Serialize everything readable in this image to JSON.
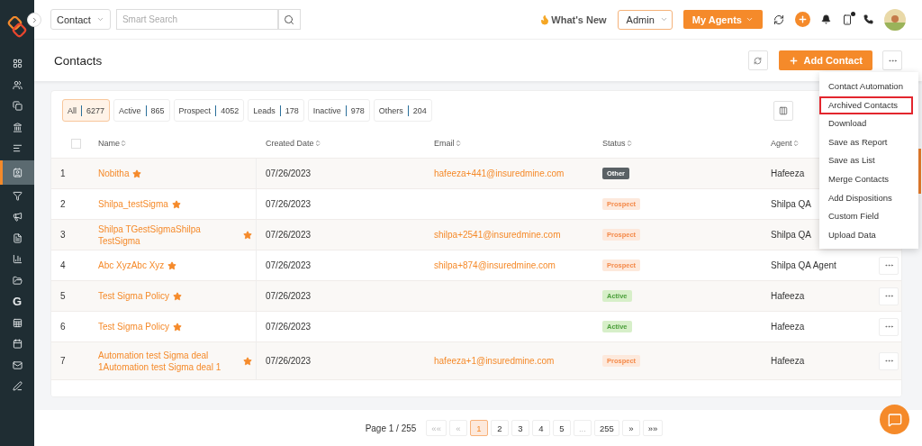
{
  "sidebar": {
    "items": [
      {
        "kind": "dashboard",
        "selected": false
      },
      {
        "kind": "users",
        "selected": false
      },
      {
        "kind": "copy",
        "selected": false
      },
      {
        "kind": "bank",
        "selected": false
      },
      {
        "kind": "list",
        "selected": false
      },
      {
        "kind": "contact",
        "selected": true
      },
      {
        "kind": "funnel",
        "selected": false
      },
      {
        "kind": "megaphone",
        "selected": false
      },
      {
        "kind": "document",
        "selected": false
      },
      {
        "kind": "chart",
        "selected": false
      },
      {
        "kind": "folder",
        "selected": false
      },
      {
        "kind": "letter",
        "label": "G",
        "selected": false
      },
      {
        "kind": "sheet",
        "selected": false
      },
      {
        "kind": "calendar",
        "selected": false
      },
      {
        "kind": "mail",
        "selected": false
      },
      {
        "kind": "signature",
        "selected": false
      }
    ]
  },
  "topbar": {
    "scope": "Contact",
    "search": {
      "placeholder": "Smart Search"
    },
    "whats_new": "What's New",
    "role": "Admin",
    "agents_button": "My Agents",
    "notification_dot": true
  },
  "page": {
    "title": "Contacts",
    "add_button": "Add Contact"
  },
  "filters": [
    {
      "label": "All",
      "count": "6277",
      "selected": true
    },
    {
      "label": "Active",
      "count": "865",
      "selected": false
    },
    {
      "label": "Prospect",
      "count": "4052",
      "selected": false
    },
    {
      "label": "Leads",
      "count": "178",
      "selected": false
    },
    {
      "label": "Inactive",
      "count": "978",
      "selected": false
    },
    {
      "label": "Others",
      "count": "204",
      "selected": false
    }
  ],
  "table": {
    "select_all_checked": false,
    "columns": [
      "Name",
      "Created Date",
      "Email",
      "Status",
      "Agent"
    ],
    "rows": [
      {
        "index": "1",
        "name": "Nobitha",
        "date": "07/26/2023",
        "email": "hafeeza+441@insuredmine.com",
        "status": {
          "label": "Other",
          "kind": "other"
        },
        "agent": "Hafeeza",
        "menu_button": false
      },
      {
        "index": "2",
        "name": "Shilpa_testSigma",
        "date": "07/26/2023",
        "status": {
          "label": "Prospect",
          "kind": "prospect"
        },
        "agent": "Shilpa QA",
        "menu_button": false
      },
      {
        "index": "3",
        "name": "Shilpa TGestSigmaShilpa TestSigma",
        "date": "07/26/2023",
        "email": "shilpa+2541@insuredmine.com",
        "status": {
          "label": "Prospect",
          "kind": "prospect"
        },
        "agent": "Shilpa QA",
        "menu_button": false
      },
      {
        "index": "4",
        "name": "Abc XyzAbc Xyz",
        "date": "07/26/2023",
        "email": "shilpa+874@insuredmine.com",
        "status": {
          "label": "Prospect",
          "kind": "prospect"
        },
        "agent": "Shilpa QA Agent",
        "menu_button": true
      },
      {
        "index": "5",
        "name": "Test Sigma Policy",
        "date": "07/26/2023",
        "status": {
          "label": "Active",
          "kind": "active"
        },
        "agent": "Hafeeza",
        "menu_button": true
      },
      {
        "index": "6",
        "name": "Test Sigma Policy",
        "date": "07/26/2023",
        "status": {
          "label": "Active",
          "kind": "active"
        },
        "agent": "Hafeeza",
        "menu_button": true
      },
      {
        "index": "7",
        "name": "Automation test Sigma deal 1Automation test Sigma deal 1",
        "date": "07/26/2023",
        "email": "hafeeza+1@insuredmine.com",
        "status": {
          "label": "Prospect",
          "kind": "prospect"
        },
        "agent": "Hafeeza",
        "menu_button": true
      }
    ]
  },
  "menu": [
    {
      "label": "Contact Automation",
      "highlighted": false
    },
    {
      "label": "Archived Contacts",
      "highlighted": true
    },
    {
      "label": "Download",
      "highlighted": false
    },
    {
      "label": "Save as Report",
      "highlighted": false
    },
    {
      "label": "Save as List",
      "highlighted": false
    },
    {
      "label": "Merge Contacts",
      "highlighted": false
    },
    {
      "label": "Add Dispositions",
      "highlighted": false
    },
    {
      "label": "Custom Field",
      "highlighted": false
    },
    {
      "label": "Upload Data",
      "highlighted": false
    }
  ],
  "pagination": {
    "label": "Page 1 / 255",
    "buttons": [
      {
        "label": "««",
        "selected": false,
        "disabled": true
      },
      {
        "label": "«",
        "selected": false,
        "disabled": true
      },
      {
        "label": "1",
        "selected": true,
        "disabled": false
      },
      {
        "label": "2",
        "selected": false,
        "disabled": false
      },
      {
        "label": "3",
        "selected": false,
        "disabled": false
      },
      {
        "label": "4",
        "selected": false,
        "disabled": false
      },
      {
        "label": "5",
        "selected": false,
        "disabled": false
      },
      {
        "label": "...",
        "selected": false,
        "disabled": true
      },
      {
        "label": "255",
        "selected": false,
        "disabled": false
      },
      {
        "label": "»",
        "selected": false,
        "disabled": false
      },
      {
        "label": "»»",
        "selected": false,
        "disabled": false
      }
    ]
  }
}
